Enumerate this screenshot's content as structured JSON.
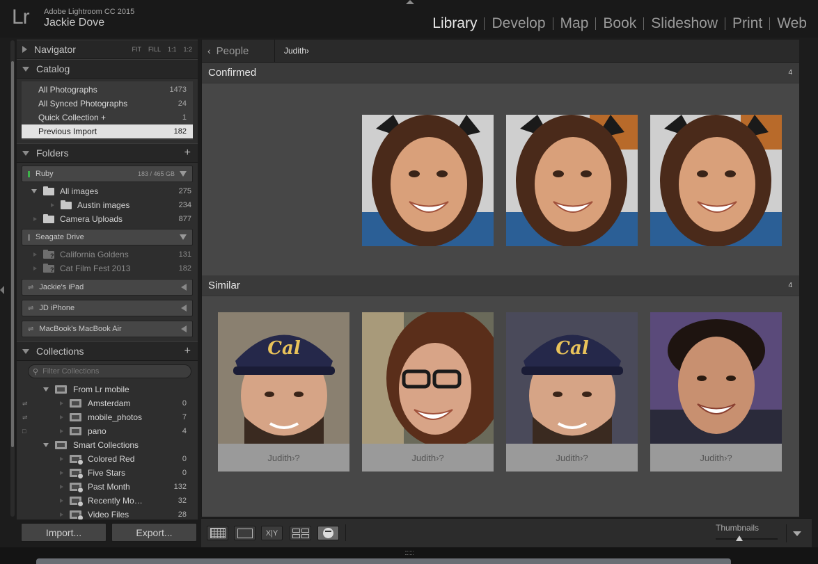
{
  "app": {
    "logo": "Lr",
    "name": "Adobe Lightroom CC 2015",
    "user": "Jackie Dove"
  },
  "modules": [
    "Library",
    "Develop",
    "Map",
    "Book",
    "Slideshow",
    "Print",
    "Web"
  ],
  "active_module": "Library",
  "navigator": {
    "title": "Navigator",
    "zoom_options": [
      "FIT",
      "FILL",
      "1:1",
      "1:2"
    ]
  },
  "catalog": {
    "title": "Catalog",
    "items": [
      {
        "label": "All Photographs",
        "count": "1473"
      },
      {
        "label": "All Synced Photographs",
        "count": "24"
      },
      {
        "label": "Quick Collection +",
        "count": "1"
      },
      {
        "label": "Previous Import",
        "count": "182"
      }
    ]
  },
  "folders": {
    "title": "Folders",
    "volumes": [
      {
        "name": "Ruby",
        "size": "183 / 465 GB"
      },
      {
        "name": "Seagate Drive",
        "size": ""
      },
      {
        "name": "Jackie's iPad"
      },
      {
        "name": "JD iPhone"
      },
      {
        "name": "MacBook's MacBook Air"
      }
    ],
    "items": [
      {
        "label": "All images",
        "count": "275"
      },
      {
        "label": "Austin images",
        "count": "234"
      },
      {
        "label": "Camera Uploads",
        "count": "877"
      },
      {
        "label": "California Goldens",
        "count": "131"
      },
      {
        "label": "Cat Film Fest 2013",
        "count": "182"
      }
    ]
  },
  "collections": {
    "title": "Collections",
    "search_placeholder": "Filter Collections",
    "sets": [
      {
        "label": "From Lr mobile"
      },
      {
        "label": "Smart Collections"
      }
    ],
    "items": [
      {
        "label": "Amsterdam",
        "count": "0"
      },
      {
        "label": "mobile_photos",
        "count": "7"
      },
      {
        "label": "pano",
        "count": "4"
      },
      {
        "label": "Colored Red",
        "count": "0"
      },
      {
        "label": "Five Stars",
        "count": "0"
      },
      {
        "label": "Past Month",
        "count": "132"
      },
      {
        "label": "Recently Mo…",
        "count": "32"
      },
      {
        "label": "Video Files",
        "count": "28"
      }
    ]
  },
  "buttons": {
    "import": "Import...",
    "export": "Export..."
  },
  "breadcrumb": {
    "back": "People",
    "current": "Judith›"
  },
  "confirmed": {
    "title": "Confirmed",
    "count": "4"
  },
  "similar": {
    "title": "Similar",
    "count": "4",
    "captions": [
      "Judith›?",
      "Judith›?",
      "Judith›?",
      "Judith›?"
    ]
  },
  "toolbar": {
    "thumbnails_label": "Thumbnails",
    "compare_label": "X|Y"
  }
}
